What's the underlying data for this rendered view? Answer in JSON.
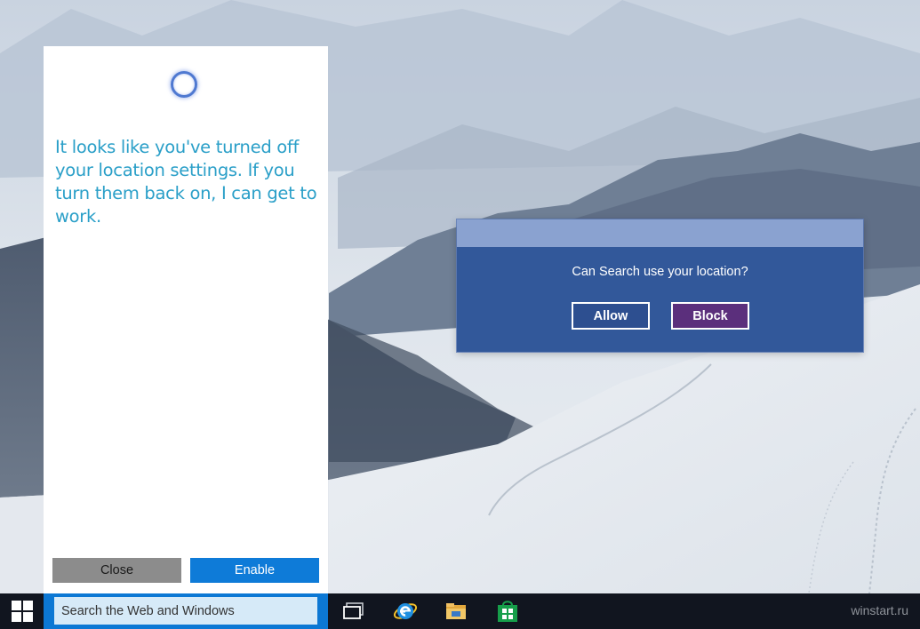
{
  "cortana": {
    "message": "It looks like you've turned off your location settings. If you turn them back on, I can get to work.",
    "close_label": "Close",
    "enable_label": "Enable"
  },
  "dialog": {
    "question": "Can Search use your location?",
    "allow_label": "Allow",
    "block_label": "Block"
  },
  "taskbar": {
    "search_placeholder": "Search the Web and Windows",
    "icons": [
      "windows-logo-icon",
      "task-view-icon",
      "internet-explorer-icon",
      "file-explorer-icon",
      "store-icon"
    ]
  },
  "watermark": "winstart.ru",
  "colors": {
    "accent": "#0e7bd8",
    "cortana_text": "#2a9fc8",
    "dialog_bg": "#32589a",
    "block_button": "#5b2f7c",
    "taskbar": "#11151f"
  }
}
